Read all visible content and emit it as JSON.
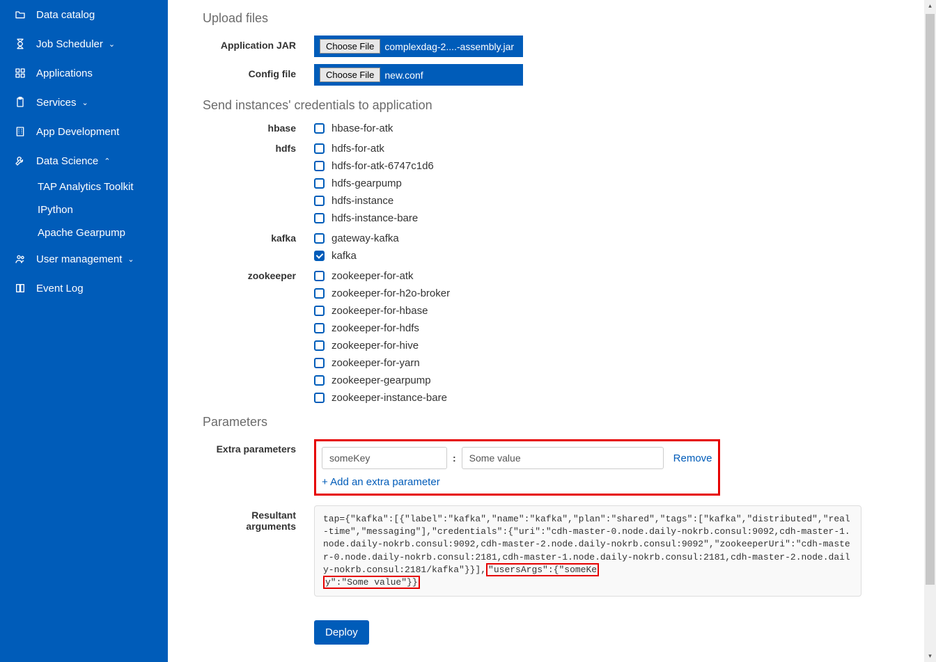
{
  "sidebar": {
    "items": [
      {
        "label": "Data catalog",
        "icon": "folder-icon",
        "chev": ""
      },
      {
        "label": "Job Scheduler",
        "icon": "hourglass-icon",
        "chev": "down"
      },
      {
        "label": "Applications",
        "icon": "grid-icon",
        "chev": ""
      },
      {
        "label": "Services",
        "icon": "clipboard-icon",
        "chev": "down"
      },
      {
        "label": "App Development",
        "icon": "building-icon",
        "chev": ""
      },
      {
        "label": "Data Science",
        "icon": "wrench-icon",
        "chev": "up"
      },
      {
        "label": "User management",
        "icon": "users-icon",
        "chev": "down"
      },
      {
        "label": "Event Log",
        "icon": "book-icon",
        "chev": ""
      }
    ],
    "data_science_sub": [
      {
        "label": "TAP Analytics Toolkit"
      },
      {
        "label": "IPython"
      },
      {
        "label": "Apache Gearpump"
      }
    ]
  },
  "upload": {
    "title": "Upload files",
    "app_jar_label": "Application JAR",
    "config_label": "Config file",
    "choose_btn": "Choose File",
    "app_jar_file": "complexdag-2....-assembly.jar",
    "config_file": "new.conf"
  },
  "credentials": {
    "title": "Send instances' credentials to application",
    "groups": [
      {
        "name": "hbase",
        "items": [
          {
            "label": "hbase-for-atk",
            "checked": false
          }
        ]
      },
      {
        "name": "hdfs",
        "items": [
          {
            "label": "hdfs-for-atk",
            "checked": false
          },
          {
            "label": "hdfs-for-atk-6747c1d6",
            "checked": false
          },
          {
            "label": "hdfs-gearpump",
            "checked": false
          },
          {
            "label": "hdfs-instance",
            "checked": false
          },
          {
            "label": "hdfs-instance-bare",
            "checked": false
          }
        ]
      },
      {
        "name": "kafka",
        "items": [
          {
            "label": "gateway-kafka",
            "checked": false
          },
          {
            "label": "kafka",
            "checked": true
          }
        ]
      },
      {
        "name": "zookeeper",
        "items": [
          {
            "label": "zookeeper-for-atk",
            "checked": false
          },
          {
            "label": "zookeeper-for-h2o-broker",
            "checked": false
          },
          {
            "label": "zookeeper-for-hbase",
            "checked": false
          },
          {
            "label": "zookeeper-for-hdfs",
            "checked": false
          },
          {
            "label": "zookeeper-for-hive",
            "checked": false
          },
          {
            "label": "zookeeper-for-yarn",
            "checked": false
          },
          {
            "label": "zookeeper-gearpump",
            "checked": false
          },
          {
            "label": "zookeeper-instance-bare",
            "checked": false
          }
        ]
      }
    ]
  },
  "params": {
    "title": "Parameters",
    "extra_label": "Extra parameters",
    "key_value": "someKey",
    "val_value": "Some value",
    "remove": "Remove",
    "add": "+ Add an extra parameter",
    "result_label": "Resultant arguments",
    "result_pre": "tap={\"kafka\":[{\"label\":\"kafka\",\"name\":\"kafka\",\"plan\":\"shared\",\"tags\":[\"kafka\",\"distributed\",\"real-time\",\"messaging\"],\"credentials\":{\"uri\":\"cdh-master-0.node.daily-nokrb.consul:9092,cdh-master-1.node.daily-nokrb.consul:9092,cdh-master-2.node.daily-nokrb.consul:9092\",\"zookeeperUri\":\"cdh-master-0.node.daily-nokrb.consul:2181,cdh-master-1.node.daily-nokrb.consul:2181,cdh-master-2.node.daily-nokrb.consul:2181/kafka\"}}],",
    "result_hl1": "\"usersArgs\":{\"someKe",
    "result_hl2": "y\":\"Some value\"}}",
    "deploy": "Deploy"
  }
}
